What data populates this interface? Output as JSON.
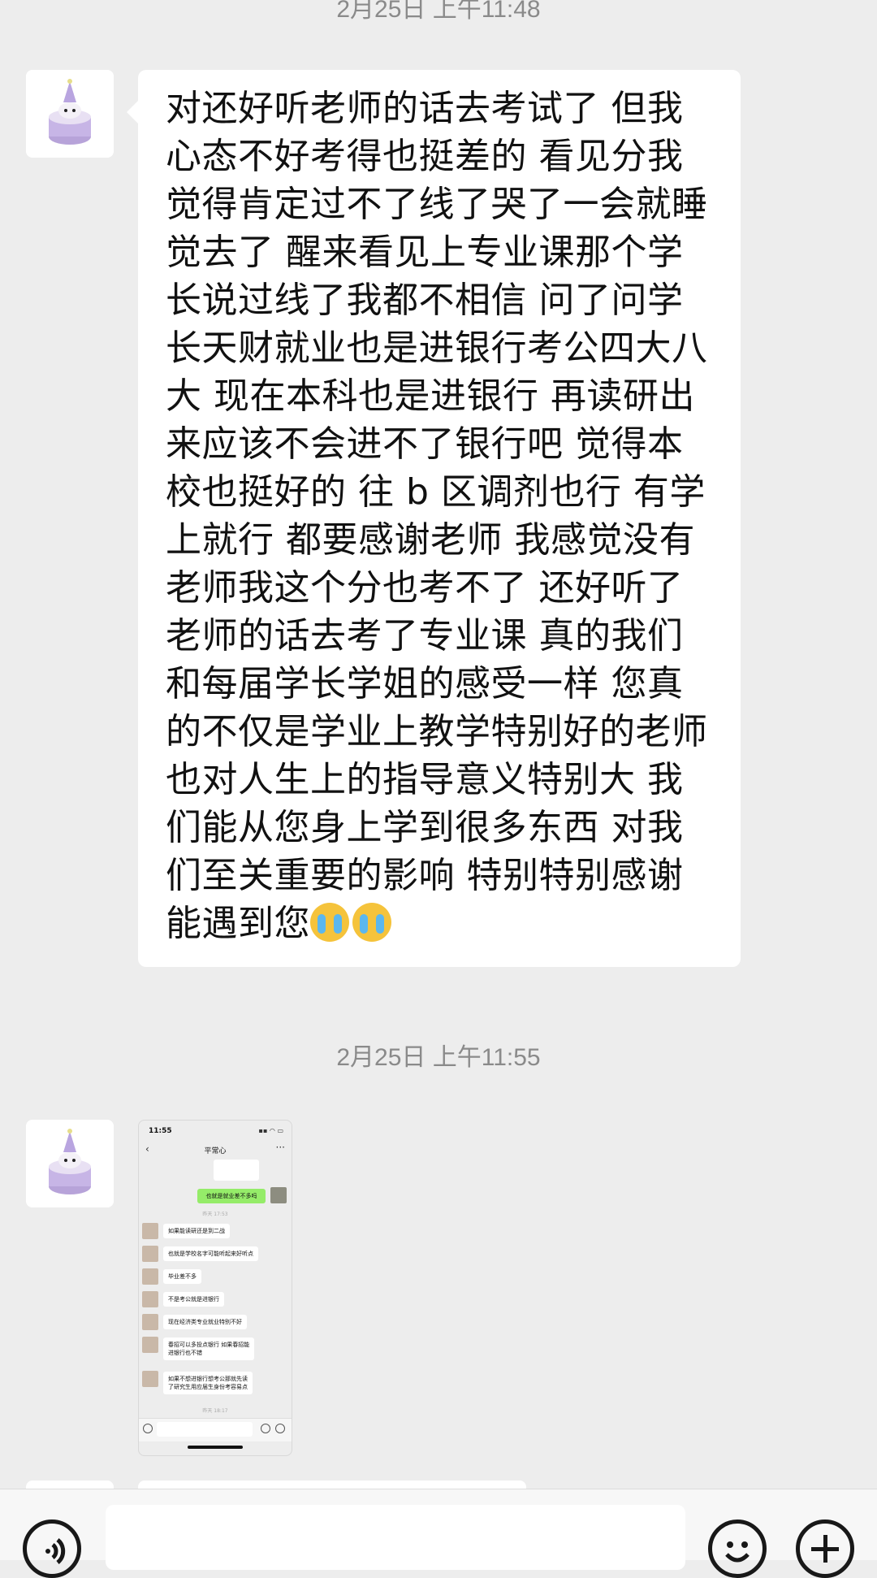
{
  "timestamps": {
    "top": "2月25日 上午11:48",
    "middle": "2月25日 上午11:55"
  },
  "message": {
    "text": "对还好听老师的话去考试了 但我心态不好考得也挺差的 看见分我觉得肯定过不了线了哭了一会就睡觉去了 醒来看见上专业课那个学长说过线了我都不相信 问了问学长天财就业也是进银行考公四大八大 现在本科也是进银行 再读研出来应该不会进不了银行吧 觉得本校也挺好的 往 b 区调剂也行 有学上就行 都要感谢老师 我感觉没有老师我这个分也考不了 还好听了老师的话去考了专业课 真的我们和每届学长学姐的感受一样 您真的不仅是学业上教学特别好的老师 也对人生上的指导意义特别大 我们能从您身上学到很多东西 对我们至关重要的影响 特别特别感谢能遇到您",
    "emoji": [
      "crying-face",
      "crying-face"
    ]
  },
  "thumbnail": {
    "status_time": "11:55",
    "status_right": "▪▪ ◠ ▭",
    "chat_title": "平常心",
    "green_message": "也就是就业差不多吗",
    "time_1": "昨天 17:53",
    "messages": [
      "如果能读研还是到二战",
      "也就是学校名字可能听起来好听点",
      "毕业差不多",
      "不是考公就是进银行",
      "现在经济类专业就业特别不好",
      "春招可以多投点银行 如果春招能\n进银行也不错",
      "如果不想进银行想考公那就先读\n了研究生用应届生身份考容易点"
    ],
    "time_2": "昨天 18:17"
  },
  "colors": {
    "background": "#ededed",
    "bubble": "#ffffff",
    "self_bubble": "#95ec69",
    "timestamp": "#8a8a8a"
  },
  "icons": {
    "voice": "voice-icon",
    "emoji": "emoji-icon",
    "add": "add-icon"
  }
}
